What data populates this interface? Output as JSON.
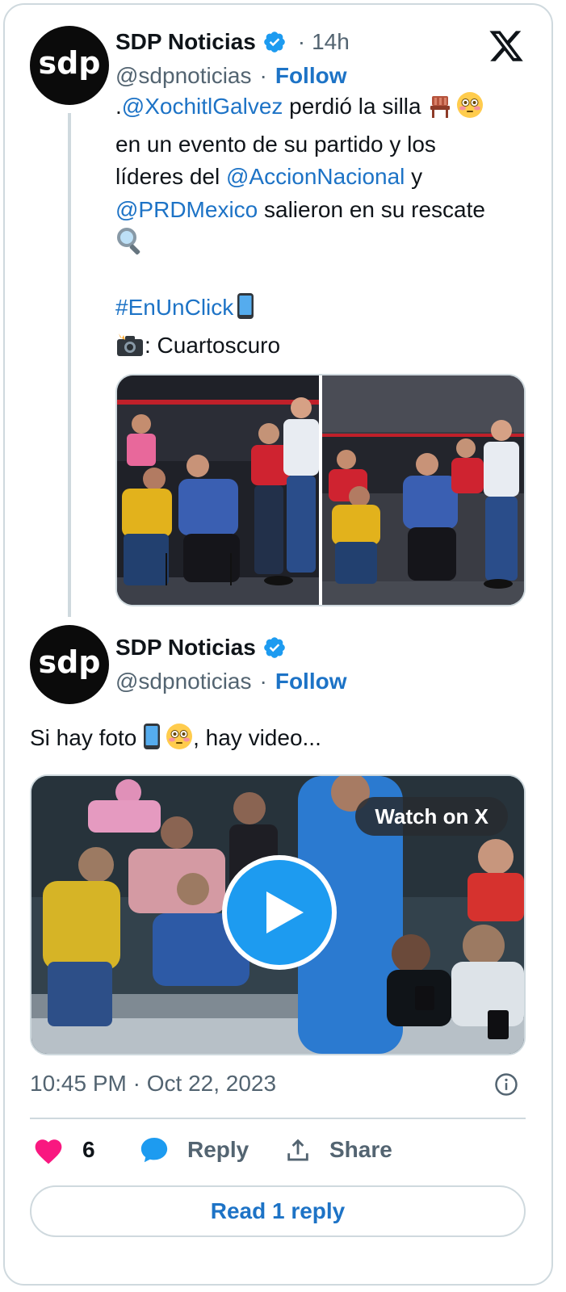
{
  "colors": {
    "accent": "#1d9bf0",
    "link": "#1d73c6",
    "like": "#f91880",
    "border": "#cfd9de",
    "muted": "#536471"
  },
  "tweet1": {
    "avatar_text": "sdp",
    "display_name": "SDP Noticias",
    "time": "14h",
    "handle": "@sdpnoticias",
    "follow": "Follow",
    "text": {
      "line1_prefix": ".",
      "mention1": "@XochitlGalvez",
      "line1_rest": " perdió la silla ",
      "line2": "en un evento de su partido y los",
      "line3_prefix": "líderes del ",
      "mention2": "@AccionNacional",
      "line3_rest": " y",
      "mention3": "@PRDMexico",
      "line4_rest": " salieron en su rescate",
      "hashtag": "#EnUnClick",
      "credit": ": Cuartoscuro"
    },
    "icons": [
      "x-logo-icon",
      "verified-badge-icon",
      "chair-icon",
      "flushed-face-icon",
      "magnifier-icon",
      "mobile-phone-icon",
      "camera-flash-icon"
    ]
  },
  "tweet2": {
    "avatar_text": "sdp",
    "display_name": "SDP Noticias",
    "handle": "@sdpnoticias",
    "follow": "Follow",
    "text_before": "Si hay foto ",
    "text_after": ", hay video...",
    "watch_label": "Watch on X",
    "timestamp": "10:45 PM · Oct 22, 2023"
  },
  "actions": {
    "like_count": "6",
    "reply_label": "Reply",
    "share_label": "Share",
    "read_replies": "Read 1 reply"
  }
}
